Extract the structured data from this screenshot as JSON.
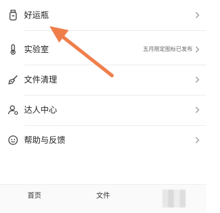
{
  "menu": {
    "items": [
      {
        "label": "好运瓶",
        "icon": "bottle-icon"
      },
      {
        "label": "实验室",
        "icon": "thermometer-icon",
        "extra": "五月限定图标已发布"
      },
      {
        "label": "文件清理",
        "icon": "broom-icon"
      },
      {
        "label": "达人中心",
        "icon": "user-badge-icon"
      },
      {
        "label": "帮助与反馈",
        "icon": "smile-icon"
      }
    ]
  },
  "tabbar": {
    "tabs": [
      {
        "label": "首页"
      },
      {
        "label": "文件"
      }
    ]
  },
  "colors": {
    "arrow": "#f07e4a",
    "text": "#222222",
    "muted": "#666666"
  }
}
